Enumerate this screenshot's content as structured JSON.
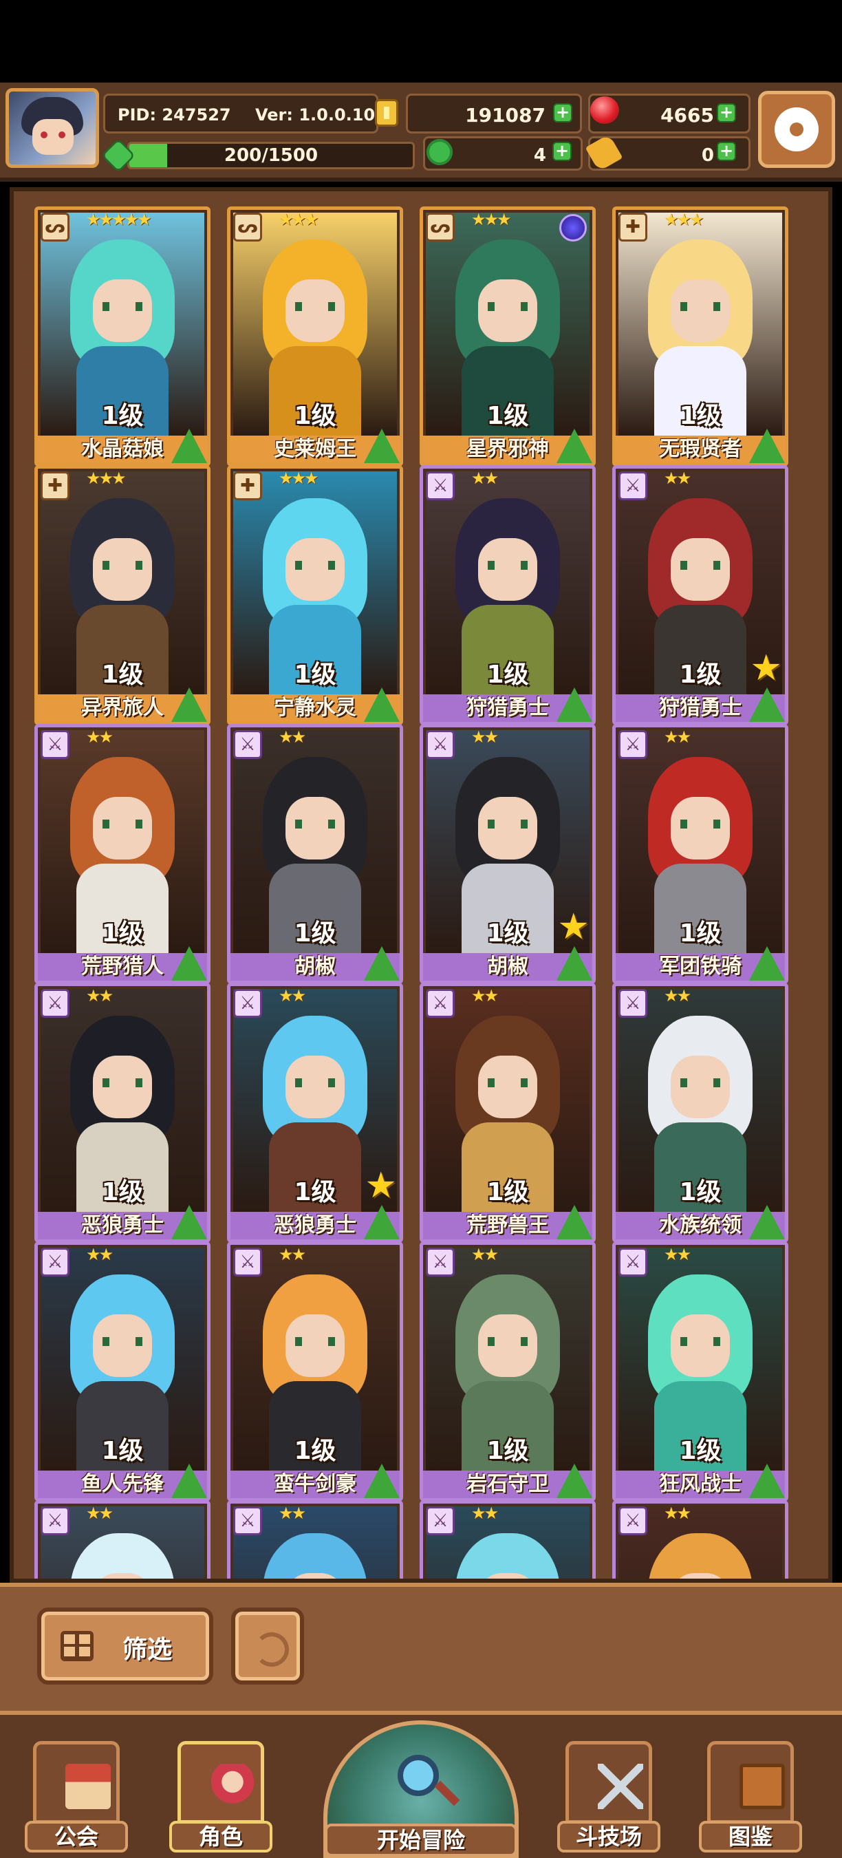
{
  "header": {
    "pid": "PID: 247527",
    "version": "Ver: 1.0.0.10",
    "gold": "191087",
    "gems": "4665",
    "stamina_text": "200/1500",
    "stamina_fraction": 0.133,
    "clovers": "4",
    "keys": "0",
    "icons": {
      "avatar": "player-avatar",
      "gold": "gold-coin-icon",
      "gems": "red-gem-icon",
      "stamina": "stamina-gem-icon",
      "clovers": "clover-icon",
      "keys": "key-icon",
      "settings": "gear-icon"
    }
  },
  "roster": {
    "cards": [
      {
        "name": "水晶菇娘",
        "level": "1级",
        "stars": "★★★★★",
        "rarity": "r3",
        "class_icon": "staff-icon",
        "hair": "#55d6c8",
        "body": "#2f7ea8",
        "bg": "#6fc2de"
      },
      {
        "name": "史莱姆王",
        "level": "1级",
        "stars": "★★★",
        "rarity": "r3",
        "class_icon": "staff-icon",
        "hair": "#f3b22a",
        "body": "#d7901b",
        "bg": "#f7d06a"
      },
      {
        "name": "星界邪神",
        "level": "1级",
        "stars": "★★★",
        "rarity": "r3",
        "class_icon": "staff-icon",
        "hair": "#2f7a5c",
        "body": "#1e4b3e",
        "bg": "#3c6a5a"
      },
      {
        "name": "无瑕贤者",
        "level": "1级",
        "stars": "★★★",
        "rarity": "r3",
        "class_icon": "cross-icon",
        "hair": "#f8d887",
        "body": "#f1f1ff",
        "bg": "#f3e6d0"
      },
      {
        "name": "异界旅人",
        "level": "1级",
        "stars": "★★★",
        "rarity": "r3",
        "class_icon": "cross-icon",
        "hair": "#2a2c3a",
        "body": "#6a4a2e",
        "bg": "#4a3a30"
      },
      {
        "name": "宁静水灵",
        "level": "1级",
        "stars": "★★★",
        "rarity": "r3",
        "class_icon": "cross-icon",
        "hair": "#5ed6f0",
        "body": "#3aa8d0",
        "bg": "#2a8ab0"
      },
      {
        "name": "狩猎勇士",
        "level": "1级",
        "stars": "★★",
        "rarity": "r2",
        "class_icon": "sword-icon",
        "hair": "#2a2440",
        "body": "#7a8a3a",
        "bg": "#4a3a3a"
      },
      {
        "name": "狩猎勇士",
        "level": "1级",
        "stars": "★★",
        "rarity": "r2",
        "class_icon": "sword-icon",
        "hair": "#a02a2a",
        "body": "#3a3530",
        "bg": "#4a302a",
        "star_badge": "★"
      },
      {
        "name": "荒野猎人",
        "level": "1级",
        "stars": "★★",
        "rarity": "r2",
        "class_icon": "sword-icon",
        "hair": "#c0602a",
        "body": "#e8e4dc",
        "bg": "#5a3a2a"
      },
      {
        "name": "胡椒",
        "level": "1级",
        "stars": "★★",
        "rarity": "r2",
        "class_icon": "sword-icon",
        "hair": "#242428",
        "body": "#6a6a72",
        "bg": "#3a2f2a"
      },
      {
        "name": "胡椒",
        "level": "1级",
        "stars": "★★",
        "rarity": "r2",
        "class_icon": "sword-icon",
        "hair": "#242428",
        "body": "#c8c8d0",
        "bg": "#3a4a5a",
        "star_badge": "★"
      },
      {
        "name": "军团铁骑",
        "level": "1级",
        "stars": "★★",
        "rarity": "r2",
        "class_icon": "sword-icon",
        "hair": "#c02a24",
        "body": "#8a8a90",
        "bg": "#4a302a"
      },
      {
        "name": "恶狼勇士",
        "level": "1级",
        "stars": "★★",
        "rarity": "r2",
        "class_icon": "sword-icon",
        "hair": "#1e1e26",
        "body": "#d8d0c0",
        "bg": "#3a2f2a"
      },
      {
        "name": "恶狼勇士",
        "level": "1级",
        "stars": "★★",
        "rarity": "r2",
        "class_icon": "sword-icon",
        "hair": "#5ec8f0",
        "body": "#6a3a2a",
        "bg": "#2a4a5a",
        "star_badge": "★"
      },
      {
        "name": "荒野兽王",
        "level": "1级",
        "stars": "★★",
        "rarity": "r2",
        "class_icon": "sword-icon",
        "hair": "#6a3a20",
        "body": "#d0a050",
        "bg": "#5a2e20"
      },
      {
        "name": "水族统领",
        "level": "1级",
        "stars": "★★",
        "rarity": "r2",
        "class_icon": "sword-icon",
        "hair": "#e8ecf0",
        "body": "#3a6a5a",
        "bg": "#2e3a3a"
      },
      {
        "name": "鱼人先锋",
        "level": "1级",
        "stars": "★★",
        "rarity": "r2",
        "class_icon": "sword-icon",
        "hair": "#5ec8f0",
        "body": "#3a3a40",
        "bg": "#2a3a4a"
      },
      {
        "name": "蛮牛剑豪",
        "level": "1级",
        "stars": "★★",
        "rarity": "r2",
        "class_icon": "sword-icon",
        "hair": "#f0a040",
        "body": "#2a2a2e",
        "bg": "#4a2e22"
      },
      {
        "name": "岩石守卫",
        "level": "1级",
        "stars": "★★",
        "rarity": "r2",
        "class_icon": "sword-icon",
        "hair": "#6a8a6a",
        "body": "#5a7a5a",
        "bg": "#3a3a32"
      },
      {
        "name": "狂风战士",
        "level": "1级",
        "stars": "★★",
        "rarity": "r2",
        "class_icon": "sword-icon",
        "hair": "#5ee0c0",
        "body": "#3ab09a",
        "bg": "#2a4a44"
      },
      {
        "name": "",
        "level": "",
        "stars": "★★",
        "rarity": "r2",
        "class_icon": "sword-icon",
        "hair": "#d8f0f8",
        "body": "#a0c8d8",
        "bg": "#3a4a5a"
      },
      {
        "name": "",
        "level": "",
        "stars": "★★",
        "rarity": "r2",
        "class_icon": "sword-icon",
        "hair": "#5ab8e8",
        "body": "#3a8ac0",
        "bg": "#2a4a6a"
      },
      {
        "name": "",
        "level": "",
        "stars": "★★",
        "rarity": "r2",
        "class_icon": "sword-icon",
        "hair": "#7ad8e8",
        "body": "#4ab0c8",
        "bg": "#2a4a5a"
      },
      {
        "name": "",
        "level": "",
        "stars": "★★",
        "rarity": "r2",
        "class_icon": "sword-icon",
        "hair": "#e8a040",
        "body": "#c07030",
        "bg": "#4a2a22"
      }
    ]
  },
  "controls": {
    "filter_label": "筛选",
    "refresh_icon": "refresh-icon",
    "filter_icon": "grid-icon"
  },
  "nav": {
    "guild": "公会",
    "character": "角色",
    "adventure": "开始冒险",
    "arena": "斗技场",
    "codex": "图鉴",
    "active": "character"
  }
}
